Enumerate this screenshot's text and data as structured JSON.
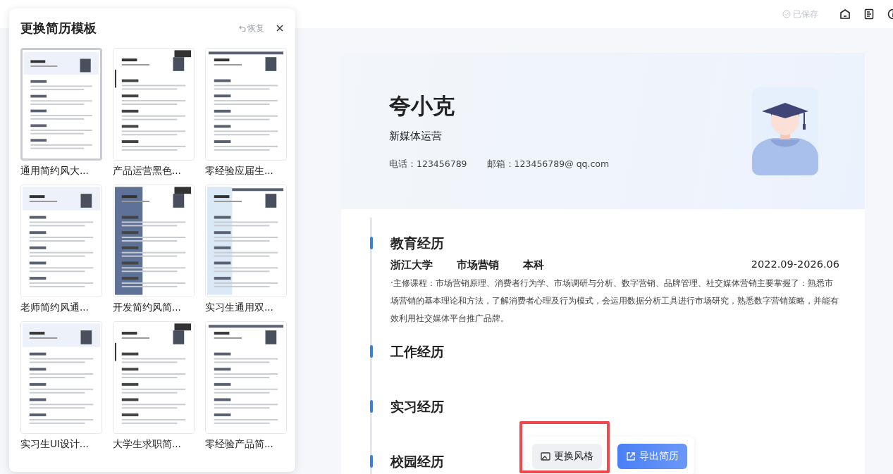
{
  "top_bar": {
    "save_status": "已保存"
  },
  "template_panel": {
    "title": "更换简历模板",
    "restore": "恢复",
    "templates": [
      {
        "label": "通用简约风大...",
        "selected": true
      },
      {
        "label": "产品运营黑色...",
        "selected": false
      },
      {
        "label": "零经验应届生...",
        "selected": false
      },
      {
        "label": "老师简约风通...",
        "selected": false
      },
      {
        "label": "开发简约风简...",
        "selected": false
      },
      {
        "label": "实习生通用双...",
        "selected": false
      },
      {
        "label": "实习生UI设计...",
        "selected": false
      },
      {
        "label": "大学生求职简...",
        "selected": false
      },
      {
        "label": "零经验产品简...",
        "selected": false
      }
    ]
  },
  "resume": {
    "name": "夸小克",
    "position": "新媒体运营",
    "contacts": [
      "电话：123456789",
      "邮箱：123456789@ qq.com"
    ],
    "sections": [
      {
        "title": "教育经历",
        "entries": [
          {
            "fields": [
              "浙江大学",
              "市场营销",
              "本科"
            ],
            "period": "2022.09-2026.06",
            "description": "·主修课程：市场营销原理、消费者行为学、市场调研与分析、数字营销、品牌管理、社交媒体营销主要掌握了：熟悉市场营销的基本理论和方法，了解消费者心理及行为模式，会运用数据分析工具进行市场研究，熟悉数字营销策略，并能有效利用社交媒体平台推广品牌。"
          }
        ]
      },
      {
        "title": "工作经历"
      },
      {
        "title": "实习经历"
      },
      {
        "title": "校园经历"
      }
    ]
  },
  "actions": [
    {
      "label": "更换风格",
      "kind": "secondary",
      "highlighted": true
    },
    {
      "label": "导出简历",
      "kind": "primary",
      "highlighted": false
    }
  ]
}
